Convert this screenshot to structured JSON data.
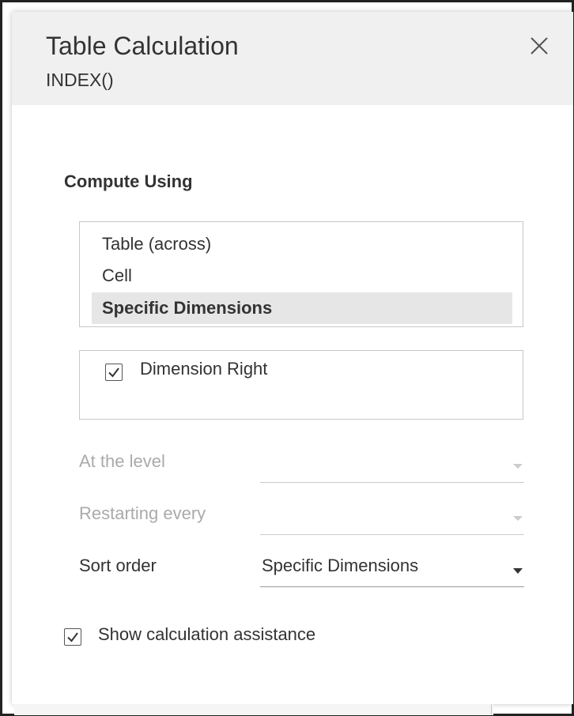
{
  "dialog": {
    "title": "Table Calculation",
    "subtitle": "INDEX()",
    "close_icon": "close-icon"
  },
  "compute_using": {
    "label": "Compute Using",
    "options": [
      {
        "label": "Table (across)",
        "selected": false
      },
      {
        "label": "Cell",
        "selected": false
      },
      {
        "label": "Specific Dimensions",
        "selected": true
      }
    ]
  },
  "dimensions": {
    "items": [
      {
        "label": "Dimension Right",
        "checked": true
      }
    ]
  },
  "fields": {
    "at_the_level": {
      "label": "At the level",
      "value": "",
      "enabled": false
    },
    "restarting_every": {
      "label": "Restarting every",
      "value": "",
      "enabled": false
    },
    "sort_order": {
      "label": "Sort order",
      "value": "Specific Dimensions",
      "enabled": true
    }
  },
  "assistance": {
    "label": "Show calculation assistance",
    "checked": true
  },
  "colors": {
    "header_bg": "#f0f0f0",
    "selected_bg": "#e6e6e6",
    "text": "#333333",
    "disabled_text": "#aaaaaa"
  }
}
